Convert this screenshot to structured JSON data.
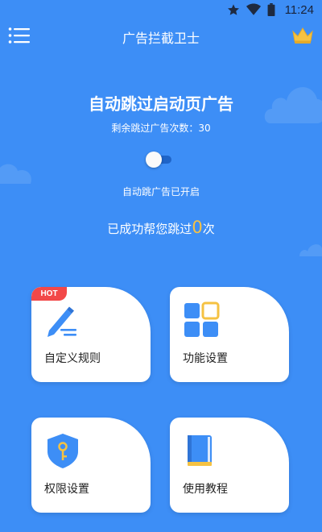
{
  "status_bar": {
    "time": "11:24"
  },
  "app_bar": {
    "title": "广告拦截卫士"
  },
  "main": {
    "headline": "自动跳过启动页广告",
    "remaining_text": "剩余跳过广告次数：30",
    "toggle_label": "自动跳广告已开启",
    "toggle_on": true,
    "success_prefix": "已成功帮您跳过",
    "success_count": "0",
    "success_suffix": "次"
  },
  "cards": {
    "custom_rules": {
      "label": "自定义规则",
      "badge": "HOT",
      "icon": "pencil-lines-icon"
    },
    "settings": {
      "label": "功能设置",
      "icon": "grid-apps-icon"
    },
    "permissions": {
      "label": "权限设置",
      "icon": "shield-key-icon"
    },
    "tutorial": {
      "label": "使用教程",
      "icon": "book-icon"
    }
  },
  "colors": {
    "background": "#3d8ef6",
    "accent": "#3d8ef6",
    "count_highlight": "#f7c244",
    "hot_badge": "#f24848",
    "crown": "#f5c242"
  }
}
